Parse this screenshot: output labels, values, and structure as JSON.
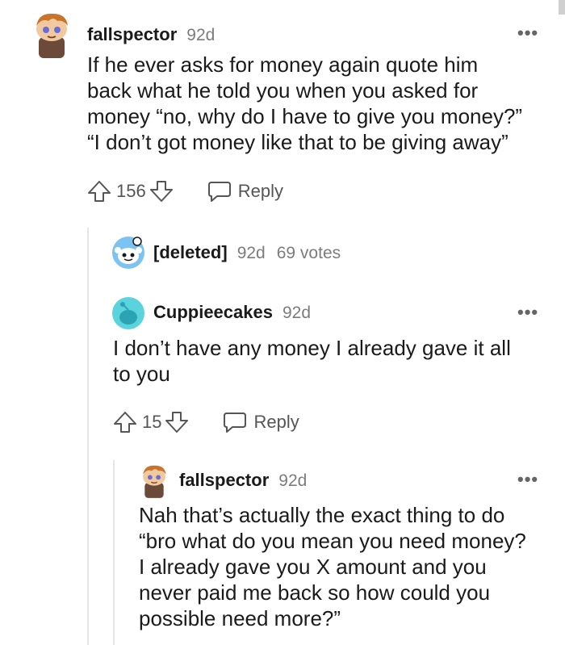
{
  "comments": [
    {
      "author": "fallspector",
      "time": "92d",
      "body_lines": [
        "If he ever asks for money again quote him",
        "back what he told you when you asked for",
        "money “no, why do I have to give you money?”",
        "“I don’t got money like that to be giving away”"
      ],
      "score": "156",
      "reply_label": "Reply",
      "avatar_icon": "snoo-avatar-brown-hair-icon"
    },
    {
      "author": "[deleted]",
      "time": "92d",
      "votes_text": "69 votes",
      "avatar_icon": "reddit-alien-default-icon"
    },
    {
      "author": "Cuppieecakes",
      "time": "92d",
      "body_lines": [
        "I don’t have any money I already gave it all",
        "to you"
      ],
      "score": "15",
      "reply_label": "Reply",
      "avatar_icon": "reddit-alien-cyan-icon"
    },
    {
      "author": "fallspector",
      "time": "92d",
      "body_lines": [
        "Nah that’s actually the exact thing to do",
        "“bro what do you mean you need money?",
        "I already gave you X amount and you",
        "never paid me back so how could you",
        "possible need more?”"
      ],
      "avatar_icon": "snoo-avatar-brown-hair-icon"
    }
  ],
  "colors": {
    "text": "#1a1a1b",
    "meta": "#7c7c7c",
    "thread_line": "#e6e6e6"
  }
}
